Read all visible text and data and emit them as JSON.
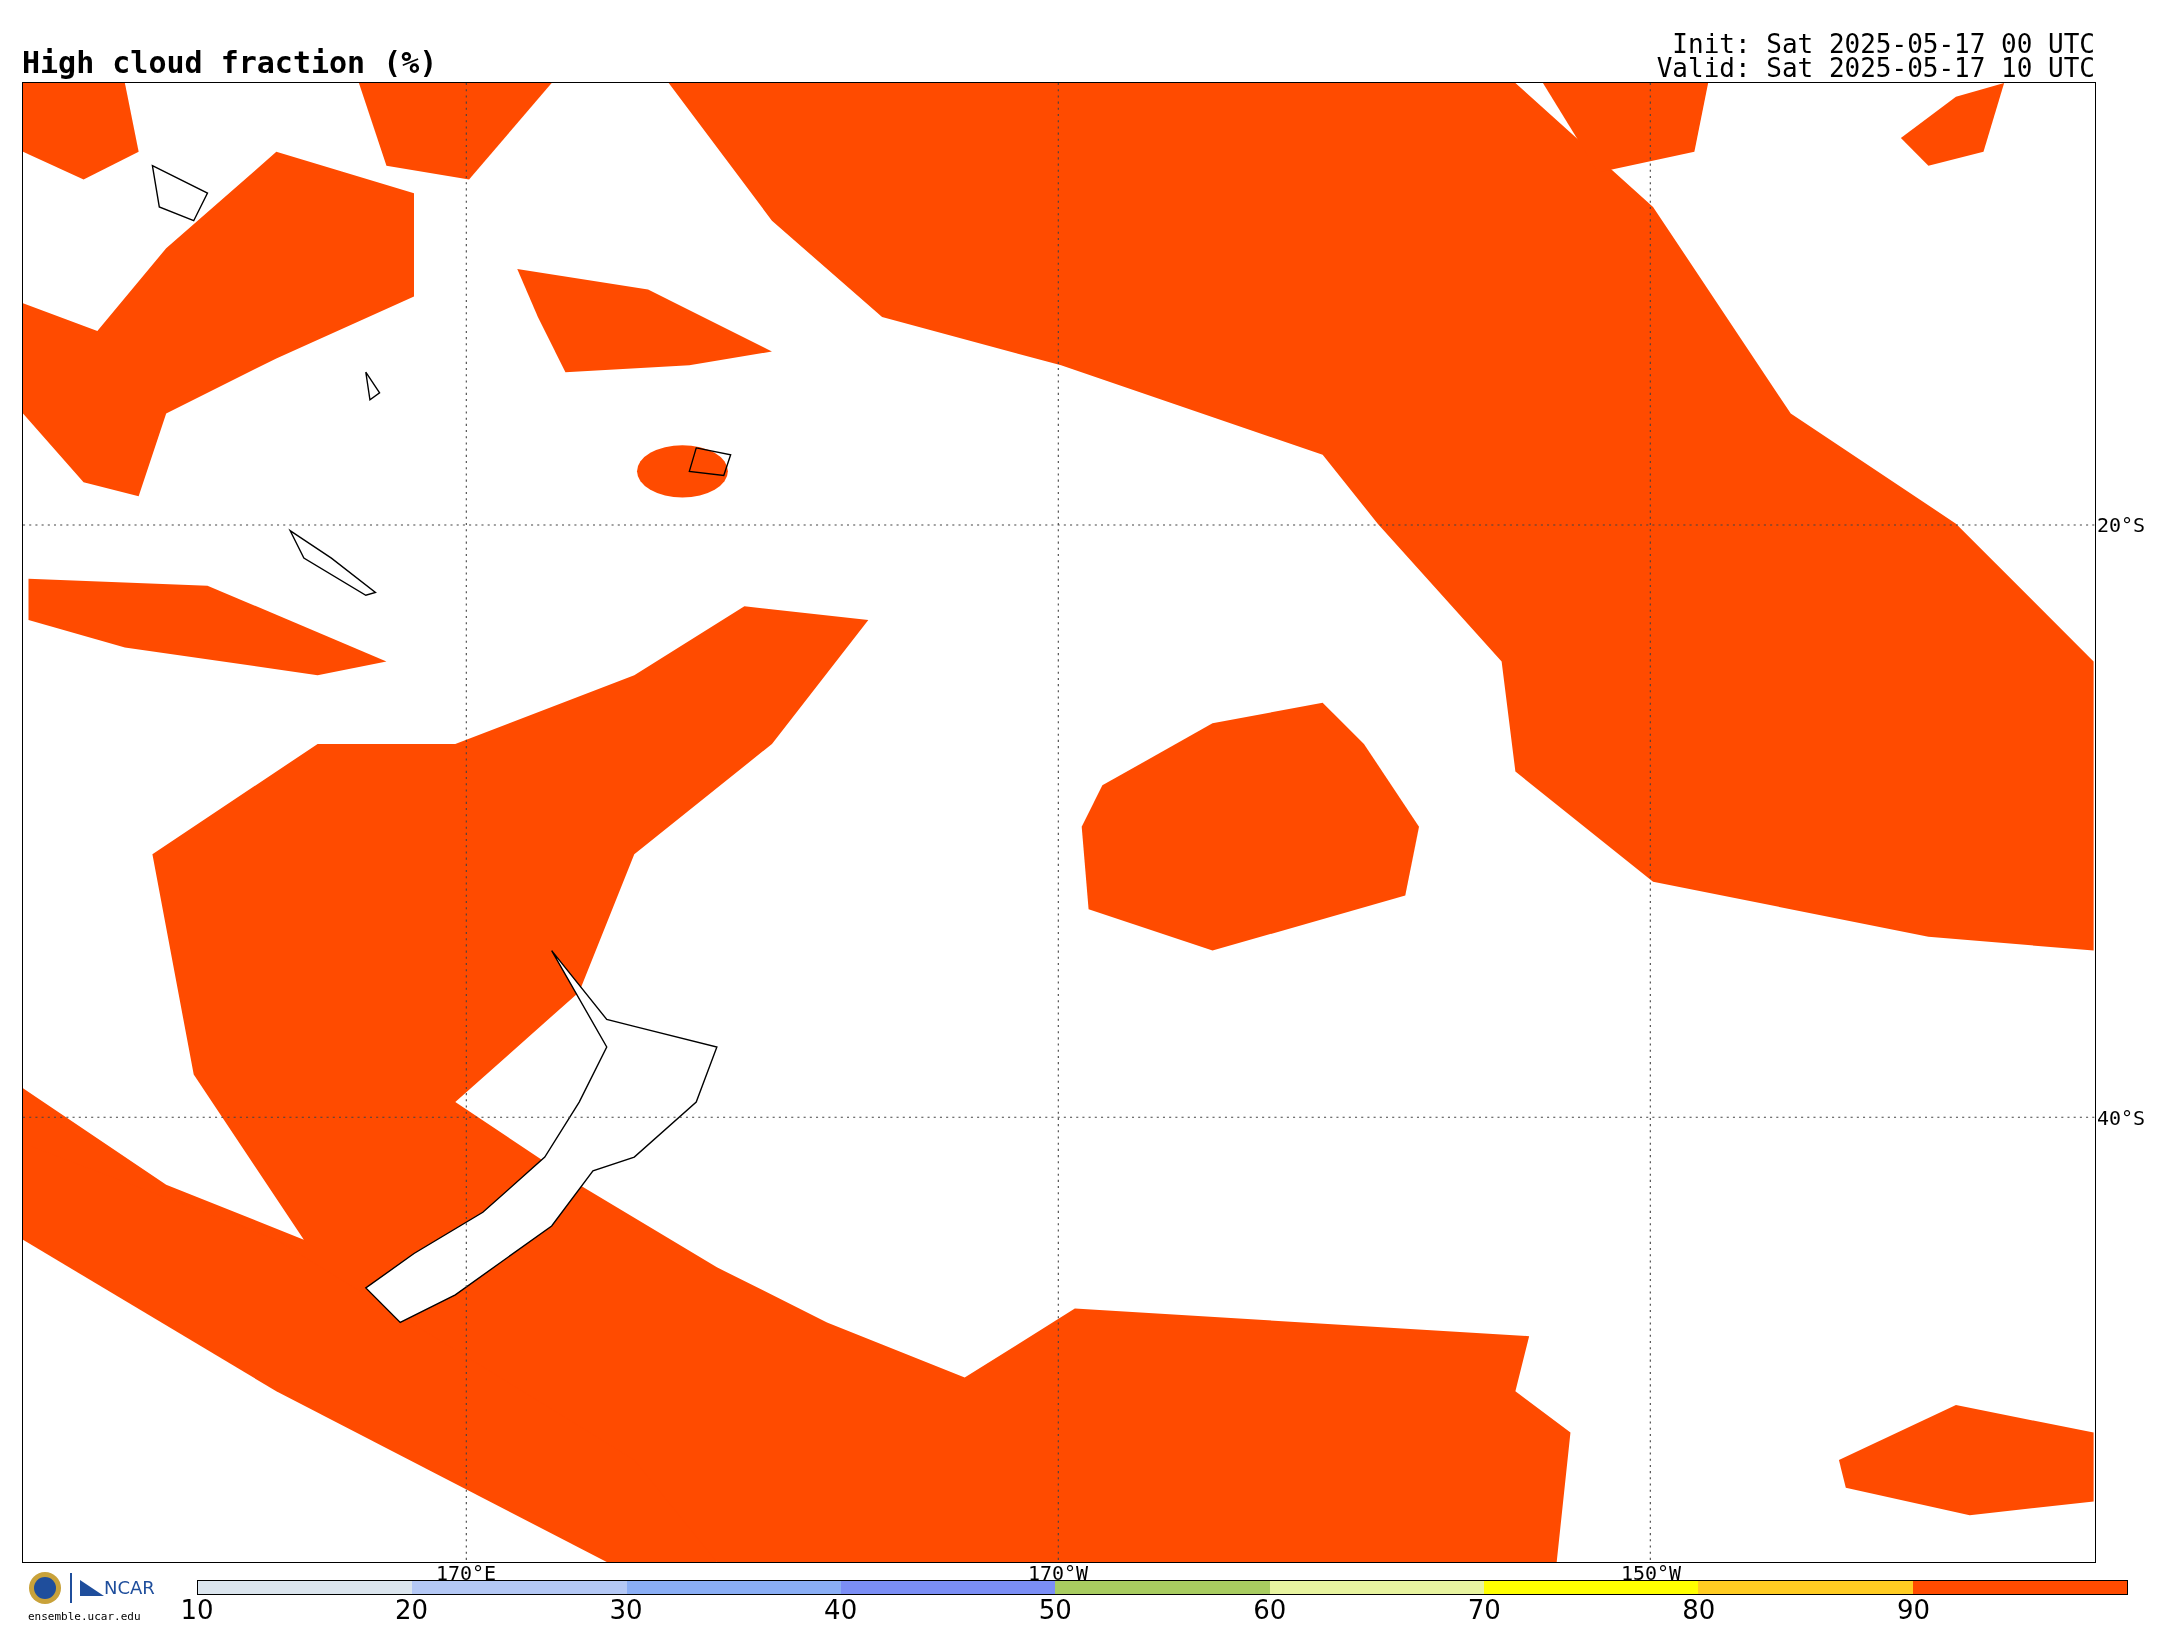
{
  "title": "High cloud fraction (%)",
  "init": "Init: Sat 2025-05-17 00 UTC",
  "valid": "Valid: Sat 2025-05-17 10 UTC",
  "map": {
    "lat_labels": [
      "20°S",
      "40°S"
    ],
    "lon_labels": [
      "170°E",
      "170°W",
      "150°W"
    ]
  },
  "logo": {
    "name": "NCAR",
    "url": "ensemble.ucar.edu"
  },
  "colorbar": {
    "segments": [
      {
        "color": "#dbe5ee"
      },
      {
        "color": "#b4c8f5"
      },
      {
        "color": "#8aaef5"
      },
      {
        "color": "#7b8ef5"
      },
      {
        "color": "#a8cc60"
      },
      {
        "color": "#e8f4a0"
      },
      {
        "color": "#ffff00"
      },
      {
        "color": "#ffcc22"
      },
      {
        "color": "#ff4b00"
      }
    ],
    "ticks": [
      "10",
      "20",
      "30",
      "40",
      "50",
      "60",
      "70",
      "80",
      "90"
    ]
  }
}
